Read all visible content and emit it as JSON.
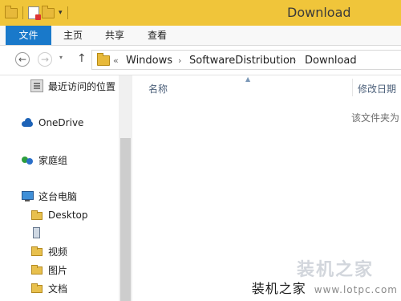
{
  "window": {
    "title": "Download",
    "accent": "#f0c53a"
  },
  "quick_access": {
    "icons": [
      "folder-icon",
      "properties-icon",
      "new-folder-icon",
      "customize-dropdown-icon"
    ]
  },
  "ribbon": {
    "tabs": [
      {
        "label": "文件",
        "active": true,
        "color": "#1979ca"
      },
      {
        "label": "主页"
      },
      {
        "label": "共享"
      },
      {
        "label": "查看"
      }
    ]
  },
  "address_bar": {
    "overflow": "«",
    "path": [
      "Windows",
      "SoftwareDistribution",
      "Download"
    ],
    "separator": "›"
  },
  "nav_pane": {
    "items": [
      {
        "label": "最近访问的位置",
        "icon": "recent-places-icon"
      },
      {
        "label": "OneDrive",
        "icon": "onedrive-icon"
      },
      {
        "label": "家庭组",
        "icon": "homegroup-icon"
      },
      {
        "label": "这台电脑",
        "icon": "this-pc-icon"
      }
    ],
    "children": [
      {
        "label": "Desktop",
        "icon": "folder-icon"
      },
      {
        "label": "",
        "icon": "device-icon"
      },
      {
        "label": "视频",
        "icon": "folder-icon"
      },
      {
        "label": "图片",
        "icon": "folder-icon"
      },
      {
        "label": "文档",
        "icon": "folder-icon"
      }
    ]
  },
  "content": {
    "columns": [
      "名称",
      "修改日期"
    ],
    "empty_message": "该文件夹为"
  },
  "watermark": {
    "text": "装机之家",
    "url": "www.lotpc.com"
  }
}
